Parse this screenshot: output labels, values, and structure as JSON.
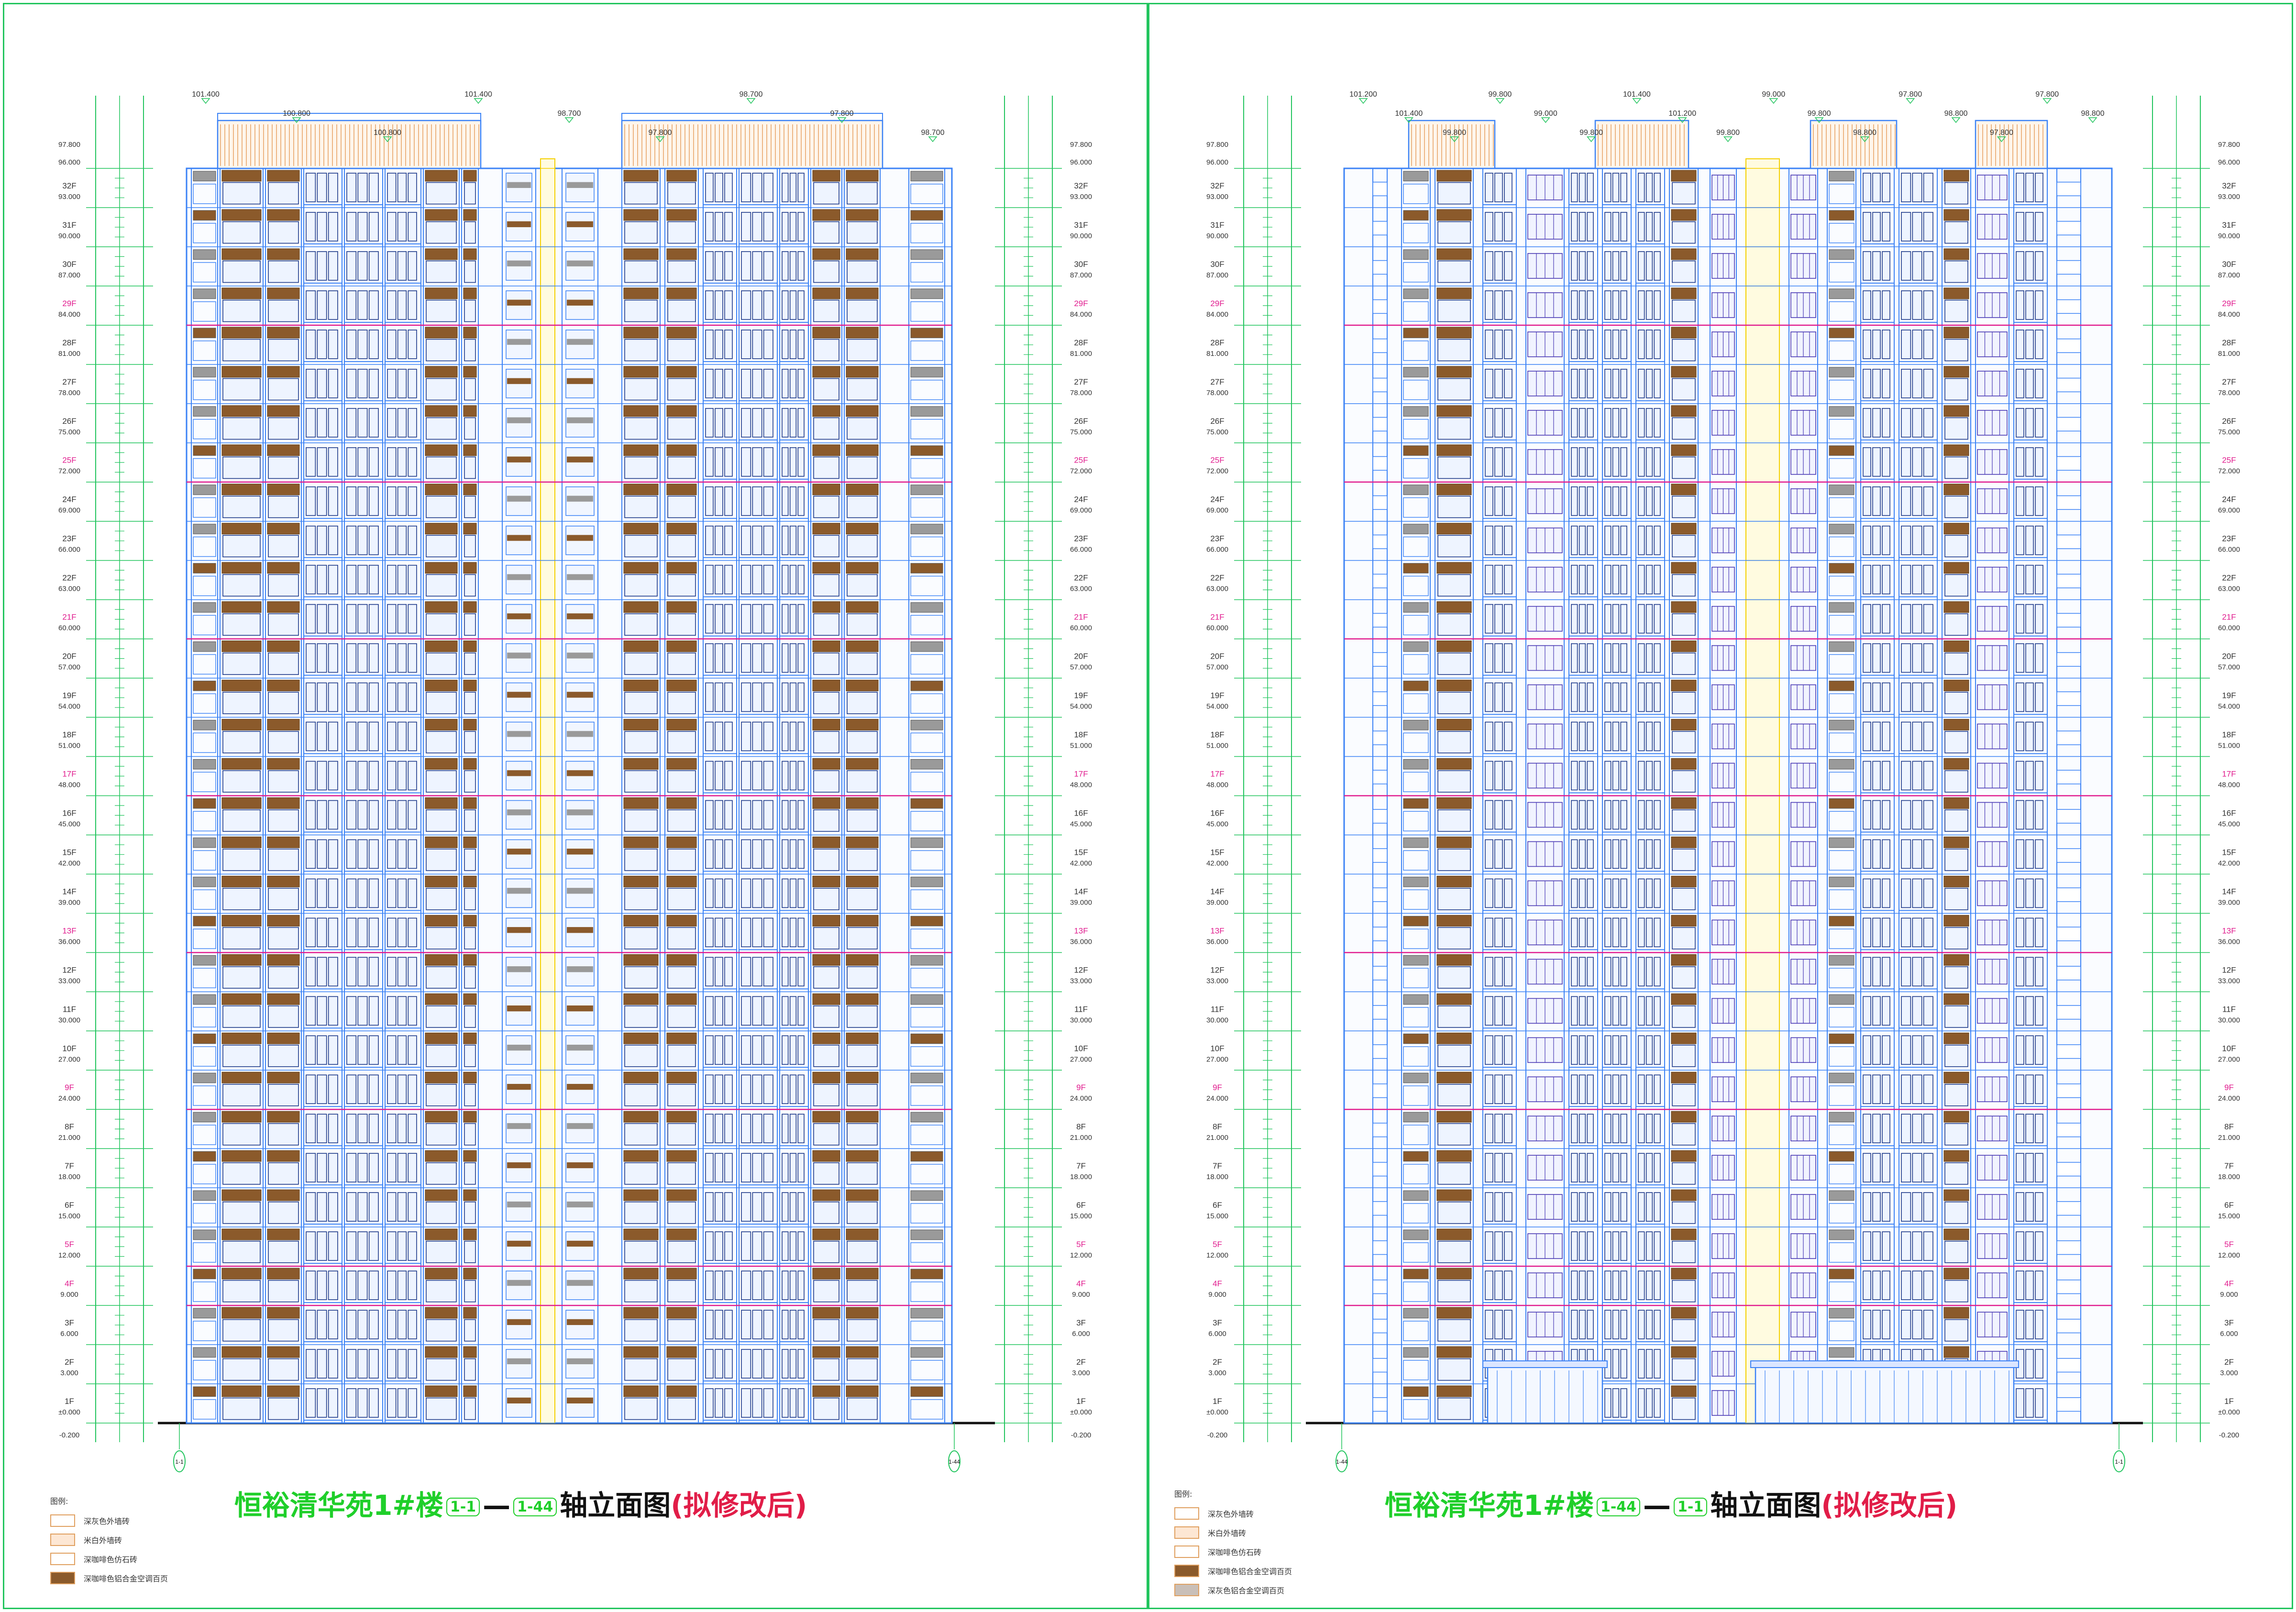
{
  "colors": {
    "frame": "#22c55e",
    "dim_line": "#22c55e",
    "wall": "#3b82f6",
    "window_dark": "#1e3a8a",
    "balcony_wood": "#8b5a2b",
    "yellow_line": "#f5d000",
    "magenta": "#e11d8f",
    "roof_hatch": "#e08a3c"
  },
  "floors": [
    {
      "label": "1F",
      "elev": "±0.000",
      "accent": false
    },
    {
      "label": "2F",
      "elev": "3.000",
      "accent": false
    },
    {
      "label": "3F",
      "elev": "6.000",
      "accent": false
    },
    {
      "label": "4F",
      "elev": "9.000",
      "accent": true
    },
    {
      "label": "5F",
      "elev": "12.000",
      "accent": true
    },
    {
      "label": "6F",
      "elev": "15.000",
      "accent": false
    },
    {
      "label": "7F",
      "elev": "18.000",
      "accent": false
    },
    {
      "label": "8F",
      "elev": "21.000",
      "accent": false
    },
    {
      "label": "9F",
      "elev": "24.000",
      "accent": true
    },
    {
      "label": "10F",
      "elev": "27.000",
      "accent": false
    },
    {
      "label": "11F",
      "elev": "30.000",
      "accent": false
    },
    {
      "label": "12F",
      "elev": "33.000",
      "accent": false
    },
    {
      "label": "13F",
      "elev": "36.000",
      "accent": true
    },
    {
      "label": "14F",
      "elev": "39.000",
      "accent": false
    },
    {
      "label": "15F",
      "elev": "42.000",
      "accent": false
    },
    {
      "label": "16F",
      "elev": "45.000",
      "accent": false
    },
    {
      "label": "17F",
      "elev": "48.000",
      "accent": true
    },
    {
      "label": "18F",
      "elev": "51.000",
      "accent": false
    },
    {
      "label": "19F",
      "elev": "54.000",
      "accent": false
    },
    {
      "label": "20F",
      "elev": "57.000",
      "accent": false
    },
    {
      "label": "21F",
      "elev": "60.000",
      "accent": true
    },
    {
      "label": "22F",
      "elev": "63.000",
      "accent": false
    },
    {
      "label": "23F",
      "elev": "66.000",
      "accent": false
    },
    {
      "label": "24F",
      "elev": "69.000",
      "accent": false
    },
    {
      "label": "25F",
      "elev": "72.000",
      "accent": true
    },
    {
      "label": "26F",
      "elev": "75.000",
      "accent": false
    },
    {
      "label": "27F",
      "elev": "78.000",
      "accent": false
    },
    {
      "label": "28F",
      "elev": "81.000",
      "accent": false
    },
    {
      "label": "29F",
      "elev": "84.000",
      "accent": true
    },
    {
      "label": "30F",
      "elev": "87.000",
      "accent": false
    },
    {
      "label": "31F",
      "elev": "90.000",
      "accent": false
    },
    {
      "label": "32F",
      "elev": "93.000",
      "accent": false
    }
  ],
  "roof_elev": "96.000",
  "top_elev": "97.800",
  "base_elev": "-0.200",
  "left_sheet": {
    "title_main": "恒裕清华苑1#楼",
    "axis_from": "1-1",
    "axis_to": "1-44",
    "title_suffix": "轴立面图",
    "title_note": "(拟修改后)",
    "axis_bubble_left": "1-1",
    "axis_bubble_right": "1-44",
    "top_labels": [
      "101.400",
      "100.800",
      "100.800",
      "101.400",
      "98.700",
      "97.800",
      "98.700",
      "97.800",
      "98.700"
    ],
    "legend_title": "图例:",
    "legend": [
      {
        "label": "深灰色外墙砖",
        "fill": "#ffffff"
      },
      {
        "label": "米白外墙砖",
        "fill": "#fde7d4"
      },
      {
        "label": "深咖啡色仿石砖",
        "fill": "#ffffff"
      },
      {
        "label": "深咖啡色铝合金空调百页",
        "fill": "#8b5a2b"
      }
    ]
  },
  "right_sheet": {
    "title_main": "恒裕清华苑1#楼",
    "axis_from": "1-44",
    "axis_to": "1-1",
    "title_suffix": "轴立面图",
    "title_note": "(拟修改后)",
    "axis_bubble_left": "1-44",
    "axis_bubble_right": "1-1",
    "top_labels": [
      "101.200",
      "101.400",
      "99.800",
      "99.800",
      "99.000",
      "99.800",
      "101.400",
      "101.200",
      "99.800",
      "99.000",
      "99.800",
      "98.800",
      "97.800",
      "98.800",
      "97.800",
      "97.800",
      "98.800"
    ],
    "legend_title": "图例:",
    "legend": [
      {
        "label": "深灰色外墙砖",
        "fill": "#ffffff"
      },
      {
        "label": "米白外墙砖",
        "fill": "#fde7d4"
      },
      {
        "label": "深咖啡色仿石砖",
        "fill": "#ffffff"
      },
      {
        "label": "深咖啡色铝合金空调百页",
        "fill": "#8b5a2b"
      },
      {
        "label": "深灰色铝合金空调百页",
        "fill": "#c9bfb8"
      }
    ]
  }
}
